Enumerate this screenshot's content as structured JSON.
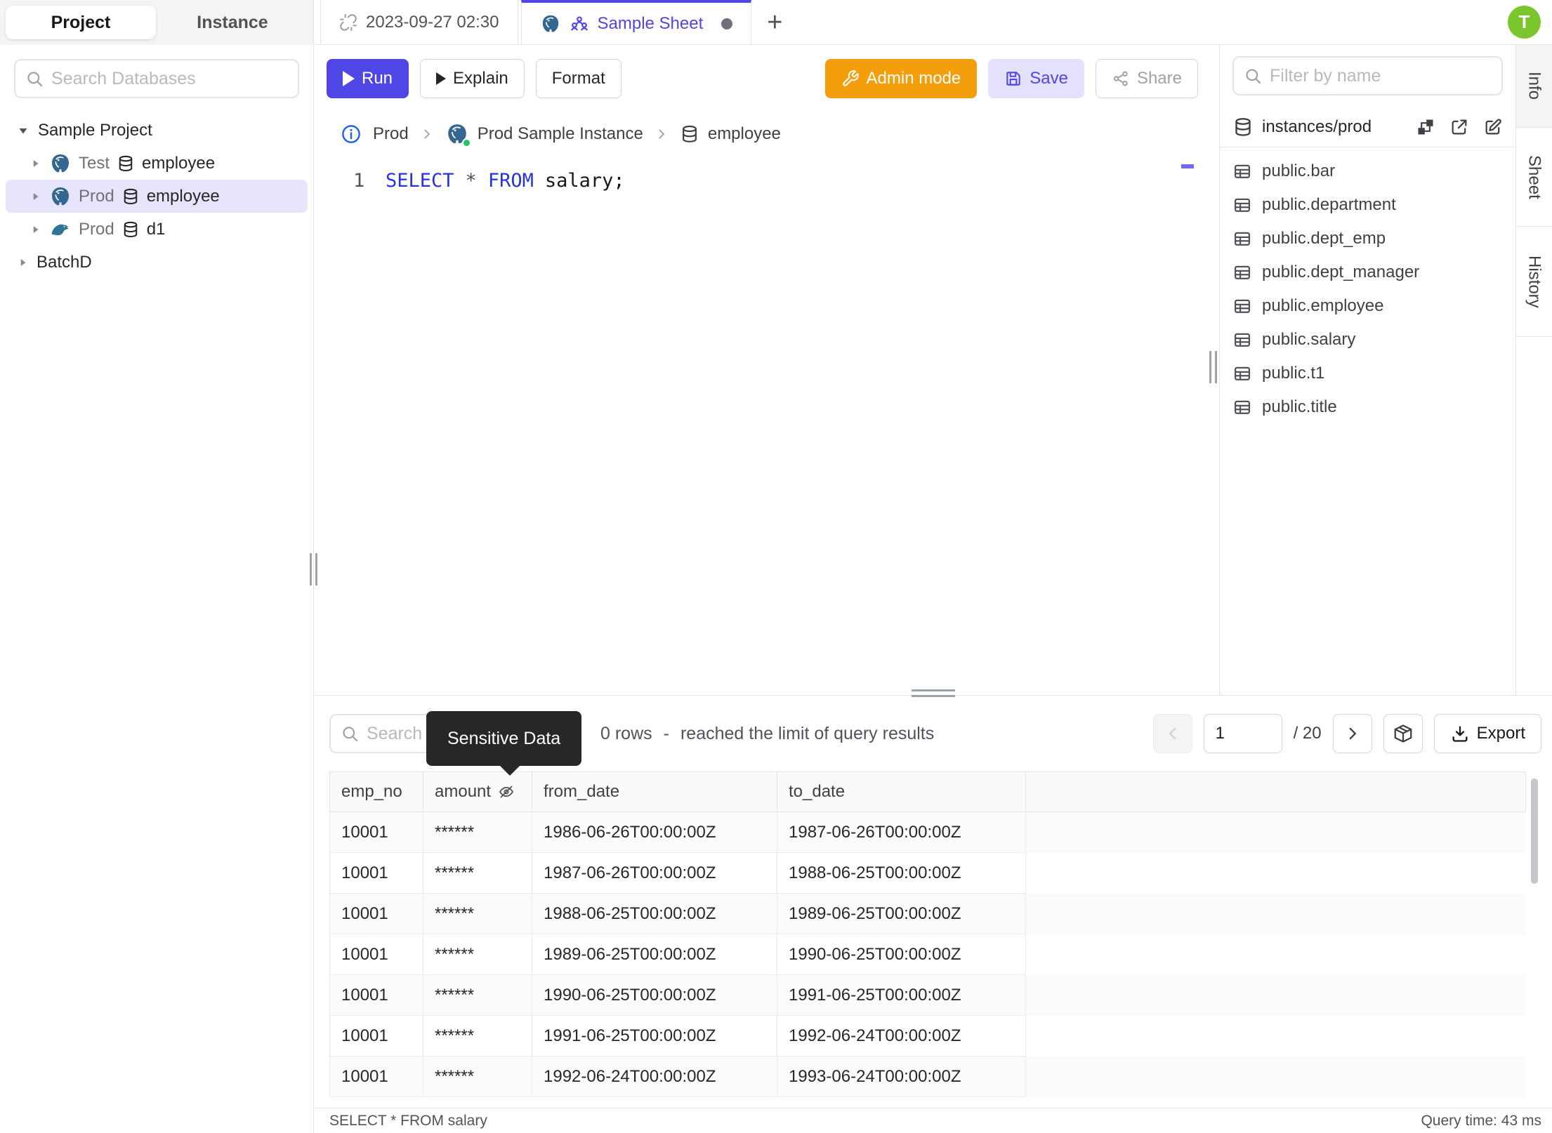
{
  "colors": {
    "accent": "#4f46e5",
    "admin_orange": "#f59e0b",
    "avatar_green": "#7bc62d",
    "keyword_blue": "#2733e0",
    "selected_row_bg": "#e7e5fc",
    "tooltip_bg": "#27272a",
    "postgres_blue": "#336791",
    "mysql_teal": "#1f6d8c",
    "status_green": "#22c55e"
  },
  "left_sidebar": {
    "tabs": {
      "project": "Project",
      "instance": "Instance"
    },
    "search_placeholder": "Search Databases",
    "tree": {
      "items": [
        {
          "label": "Sample Project"
        },
        {
          "env": "Test",
          "name": "employee"
        },
        {
          "env": "Prod",
          "name": "employee"
        },
        {
          "env": "Prod",
          "name": "d1"
        },
        {
          "label": "BatchD"
        }
      ]
    }
  },
  "tab_bar": {
    "sheet_tab_1": "2023-09-27 02:30",
    "sheet_tab_2": "Sample Sheet",
    "new_tab": "+",
    "avatar_initial": "T"
  },
  "toolbar": {
    "run": "Run",
    "explain": "Explain",
    "format": "Format",
    "admin_mode": "Admin mode",
    "save": "Save",
    "share": "Share"
  },
  "breadcrumb": {
    "environment": "Prod",
    "instance": "Prod Sample Instance",
    "database": "employee"
  },
  "editor": {
    "line_number": "1",
    "keyword_select": "SELECT",
    "star": "*",
    "keyword_from": "FROM",
    "identifier": "salary;"
  },
  "right_sidebar": {
    "filter_placeholder": "Filter by name",
    "header_label": "instances/prod",
    "icons": [
      "schema-diagram-icon",
      "external-link-icon",
      "edit-icon"
    ],
    "tables": [
      "public.bar",
      "public.department",
      "public.dept_emp",
      "public.dept_manager",
      "public.employee",
      "public.salary",
      "public.t1",
      "public.title"
    ]
  },
  "side_tabs": {
    "info": "Info",
    "sheet": "Sheet",
    "history": "History"
  },
  "results": {
    "search_placeholder": "Search",
    "tooltip": "Sensitive Data",
    "row_count": "0 rows",
    "dash": "-",
    "limit_notice": "reached the limit of query results",
    "page_value": "1",
    "page_total": "/ 20",
    "export_label": "Export",
    "columns": [
      "emp_no",
      "amount",
      "from_date",
      "to_date"
    ],
    "rows": [
      [
        "10001",
        "******",
        "1986-06-26T00:00:00Z",
        "1987-06-26T00:00:00Z"
      ],
      [
        "10001",
        "******",
        "1987-06-26T00:00:00Z",
        "1988-06-25T00:00:00Z"
      ],
      [
        "10001",
        "******",
        "1988-06-25T00:00:00Z",
        "1989-06-25T00:00:00Z"
      ],
      [
        "10001",
        "******",
        "1989-06-25T00:00:00Z",
        "1990-06-25T00:00:00Z"
      ],
      [
        "10001",
        "******",
        "1990-06-25T00:00:00Z",
        "1991-06-25T00:00:00Z"
      ],
      [
        "10001",
        "******",
        "1991-06-25T00:00:00Z",
        "1992-06-24T00:00:00Z"
      ],
      [
        "10001",
        "******",
        "1992-06-24T00:00:00Z",
        "1993-06-24T00:00:00Z"
      ]
    ]
  },
  "status_bar": {
    "statement": "SELECT * FROM salary",
    "query_time": "Query time: 43 ms"
  }
}
